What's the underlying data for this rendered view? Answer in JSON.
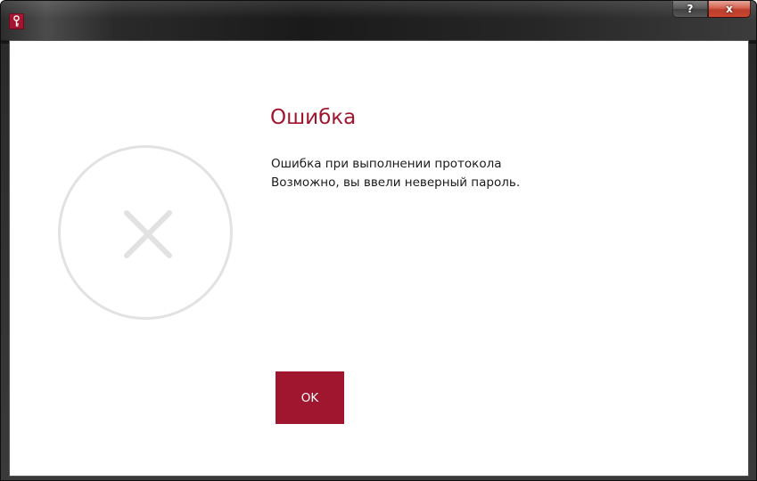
{
  "titlebar": {
    "help_label": "?",
    "close_label": "x",
    "icon": "key-icon"
  },
  "dialog": {
    "title": "Ошибка",
    "message_lines": [
      "Ошибка при выполнении протокола",
      "Возможно, вы ввели неверный пароль."
    ],
    "status_icon": "error-x-icon",
    "ok_label": "OK"
  },
  "colors": {
    "accent": "#a0162f",
    "icon_gray": "#e2e2e2",
    "titlebar": "#1a1a1a"
  }
}
